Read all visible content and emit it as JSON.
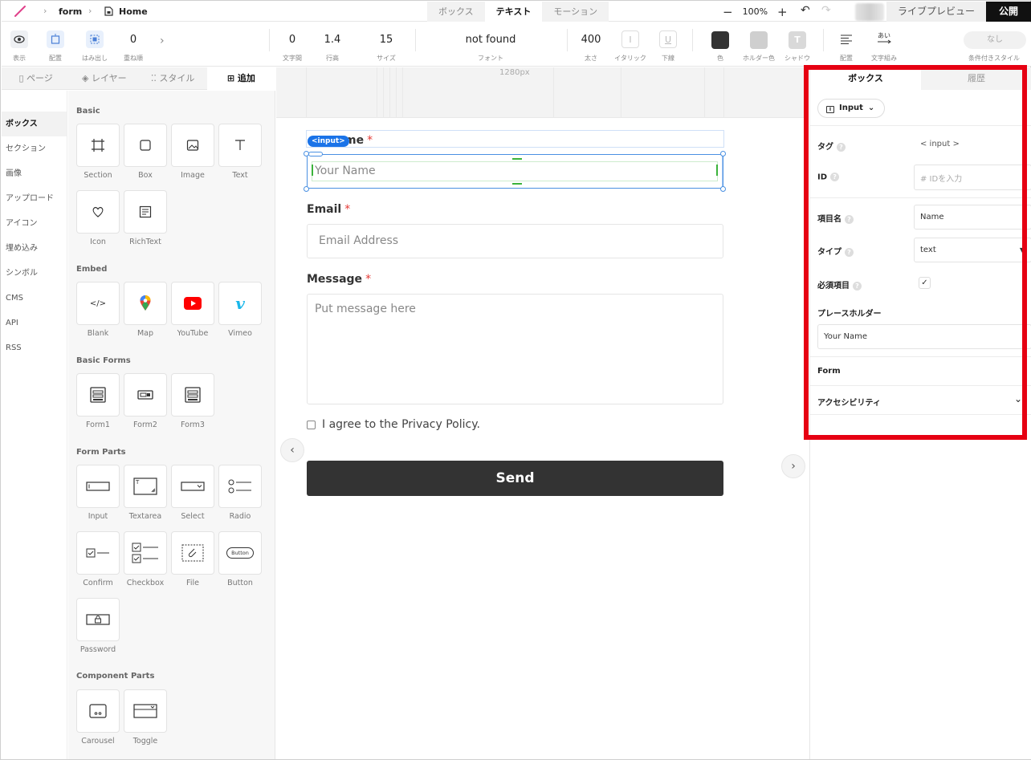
{
  "topbar": {
    "breadcrumb_project": "form",
    "breadcrumb_page": "Home",
    "mode_tabs": [
      "ボックス",
      "テキスト",
      "モーション"
    ],
    "active_mode": 1,
    "zoom_minus": "−",
    "zoom_level": "100%",
    "zoom_plus": "+",
    "live_preview": "ライブプレビュー",
    "publish": "公開"
  },
  "toolbar": {
    "display_label": "表示",
    "placement_label": "配置",
    "overflow_label": "はみ出し",
    "zindex_value": "0",
    "zindex_label": "重ね順",
    "letter_spacing_value": "0",
    "letter_spacing_label": "文字間",
    "line_height_value": "1.4",
    "line_height_label": "行高",
    "size_value": "15",
    "size_label": "サイズ",
    "font_value": "not found",
    "font_label": "フォント",
    "weight_value": "400",
    "weight_label": "太さ",
    "italic_label": "イタリック",
    "underline_label": "下線",
    "color_label": "色",
    "holder_color_label": "ホルダー色",
    "shadow_label": "シャドウ",
    "align_label": "配置",
    "text_set_label": "文字組み",
    "conditional_value": "なし",
    "conditional_label": "条件付きスタイル",
    "colors": {
      "text": "#333333",
      "holder": "#cfcfcf",
      "shadow": "#d9d9d9"
    }
  },
  "left_panel": {
    "tabs": [
      "ページ",
      "レイヤー",
      "スタイル",
      "追加"
    ],
    "active_tab": 3,
    "categories": [
      "ボックス",
      "セクション",
      "画像",
      "アップロード",
      "アイコン",
      "埋め込み",
      "シンボル",
      "CMS",
      "API",
      "RSS"
    ],
    "active_category": 0,
    "sections": {
      "basic": {
        "title": "Basic",
        "items": [
          "Section",
          "Box",
          "Image",
          "Text",
          "Icon",
          "RichText"
        ]
      },
      "embed": {
        "title": "Embed",
        "items": [
          "Blank",
          "Map",
          "YouTube",
          "Vimeo"
        ]
      },
      "basic_forms": {
        "title": "Basic Forms",
        "items": [
          "Form1",
          "Form2",
          "Form3"
        ]
      },
      "form_parts": {
        "title": "Form Parts",
        "items": [
          "Input",
          "Textarea",
          "Select",
          "Radio",
          "Confirm",
          "Checkbox",
          "File",
          "Button",
          "Password"
        ]
      },
      "component_parts": {
        "title": "Component Parts",
        "items": [
          "Carousel",
          "Toggle"
        ]
      }
    },
    "button_icon_text": "Button"
  },
  "canvas": {
    "ruler_label": "1280px",
    "selected_tag": "<input>",
    "name_label_partial": "me",
    "required_mark": "*",
    "name_placeholder": "Your Name",
    "email_label": "Email",
    "email_placeholder": "Email Address",
    "message_label": "Message",
    "message_placeholder": "Put message here",
    "agree_text": "I agree to the Privacy Policy.",
    "send_label": "Send"
  },
  "right_panel": {
    "tabs": [
      "ボックス",
      "履歴"
    ],
    "active_tab": 0,
    "element_type": "Input",
    "tag_label": "タグ",
    "tag_value": "< input >",
    "id_label": "ID",
    "id_placeholder": "# IDを入力",
    "item_name_label": "項目名",
    "item_name_value": "Name",
    "type_label": "タイプ",
    "type_value": "text",
    "required_label": "必須項目",
    "required_checked": true,
    "placeholder_label": "プレースホルダー",
    "placeholder_value": "Your Name",
    "form_label": "Form",
    "accessibility_label": "アクセシビリティ",
    "highlight_color": "#e60012"
  }
}
